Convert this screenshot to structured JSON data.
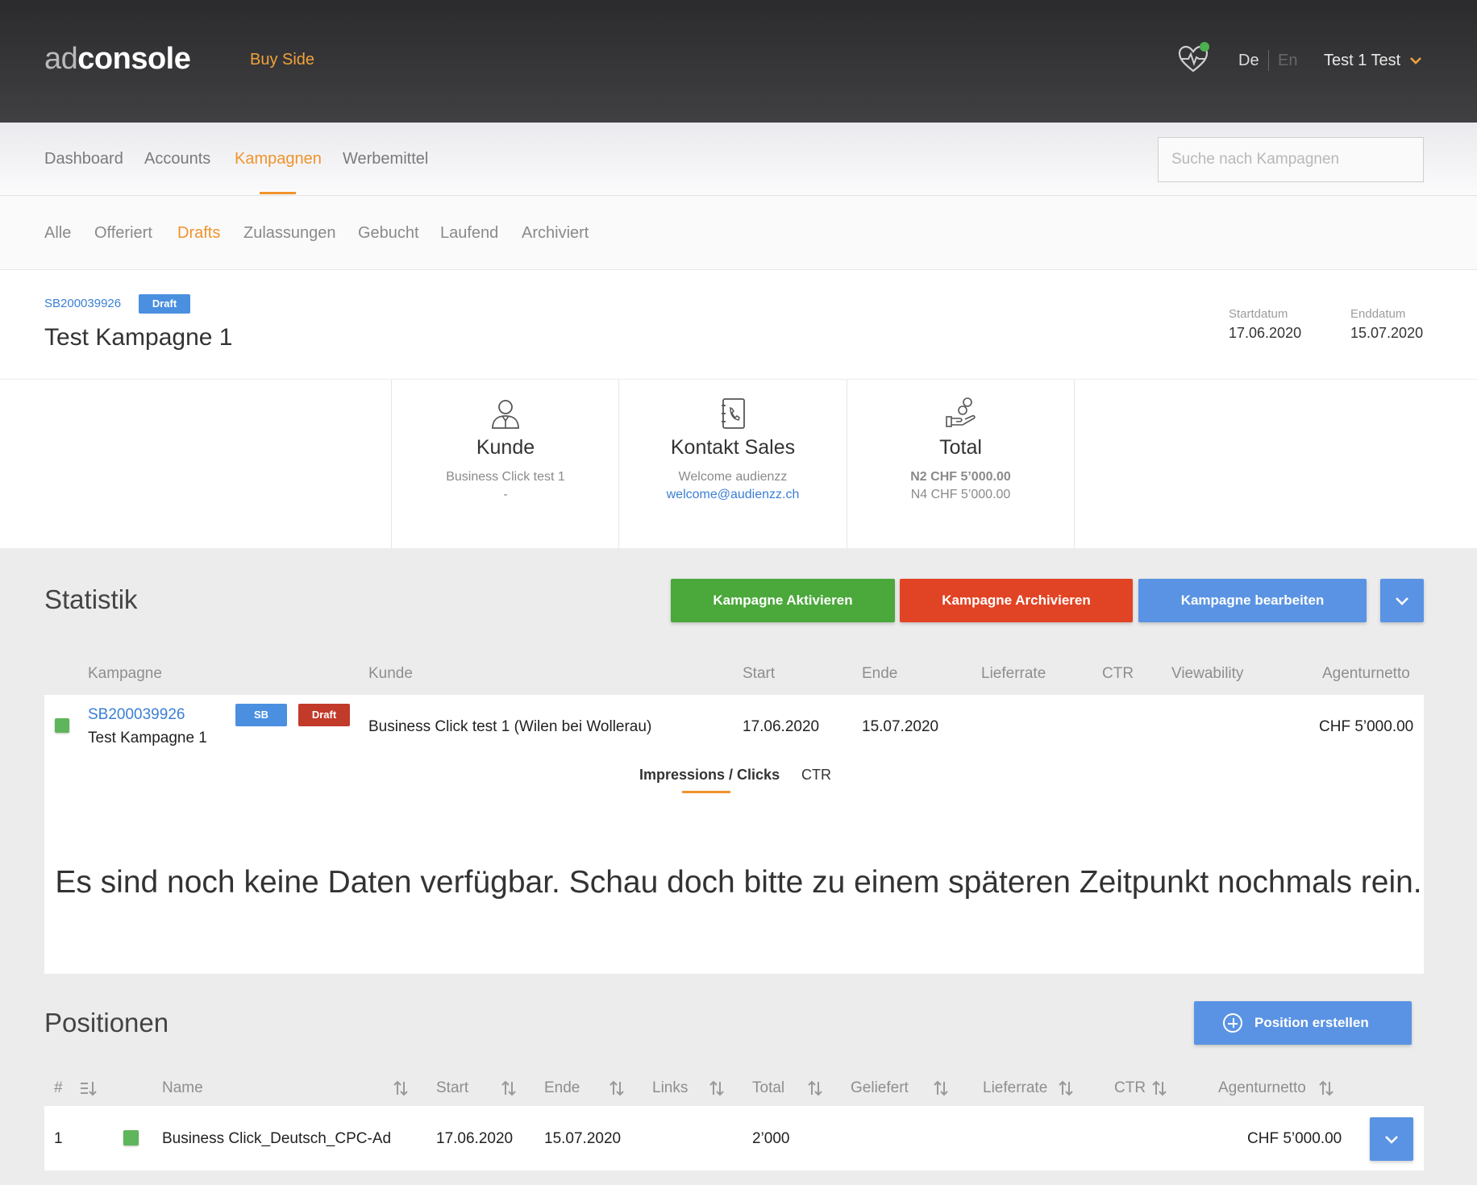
{
  "header": {
    "logo_part1": "ad",
    "logo_part2": "console",
    "section": "Buy Side",
    "lang_de": "De",
    "lang_en": "En",
    "user": "Test 1 Test"
  },
  "main_nav": {
    "items": [
      "Dashboard",
      "Accounts",
      "Kampagnen",
      "Werbemittel"
    ],
    "active": "Kampagnen",
    "search_placeholder": "Suche nach Kampagnen"
  },
  "sub_nav": {
    "items": [
      "Alle",
      "Offeriert",
      "Drafts",
      "Zulassungen",
      "Gebucht",
      "Laufend",
      "Archiviert"
    ],
    "active": "Drafts"
  },
  "campaign": {
    "id": "SB200039926",
    "status": "Draft",
    "title": "Test Kampagne 1",
    "start_label": "Startdatum",
    "start": "17.06.2020",
    "end_label": "Enddatum",
    "end": "15.07.2020"
  },
  "cards": {
    "kunde": {
      "title": "Kunde",
      "line1": "Business Click test 1",
      "line2": "-"
    },
    "kontakt": {
      "title": "Kontakt Sales",
      "line1": "Welcome audienzz",
      "line2": "welcome@audienzz.ch"
    },
    "total": {
      "title": "Total",
      "line1": "N2 CHF 5’000.00",
      "line2": "N4 CHF 5’000.00"
    }
  },
  "statistik": {
    "title": "Statistik",
    "buttons": {
      "activate": "Kampagne Aktivieren",
      "archive": "Kampagne Archivieren",
      "edit": "Kampagne bearbeiten"
    },
    "columns": [
      "Kampagne",
      "Kunde",
      "Start",
      "Ende",
      "Lieferrate",
      "CTR",
      "Viewability",
      "Agenturnetto"
    ],
    "row": {
      "id": "SB200039926",
      "name": "Test Kampagne 1",
      "tag1": "SB",
      "tag2": "Draft",
      "kunde": "Business Click test 1 (Wilen bei Wollerau)",
      "start": "17.06.2020",
      "ende": "15.07.2020",
      "agenturnetto": "CHF 5’000.00"
    },
    "tabs": [
      "Impressions / Clicks",
      "CTR"
    ],
    "active_tab": "Impressions / Clicks",
    "empty_message": "Es sind noch keine Daten verfügbar. Schau doch bitte zu einem späteren Zeitpunkt nochmals rein."
  },
  "positionen": {
    "title": "Positionen",
    "create_button": "Position erstellen",
    "columns": [
      "#",
      "Name",
      "Start",
      "Ende",
      "Links",
      "Total",
      "Geliefert",
      "Lieferrate",
      "CTR",
      "Agenturnetto"
    ],
    "rows": [
      {
        "num": "1",
        "name": "Business Click_Deutsch_CPC-Ad",
        "start": "17.06.2020",
        "ende": "15.07.2020",
        "total": "2’000",
        "agenturnetto": "CHF 5’000.00"
      }
    ]
  },
  "colors": {
    "accent": "#f0932b",
    "link": "#3b7fd4",
    "green": "#4ba83b",
    "red": "#e14424",
    "blue": "#5a93e3"
  },
  "icons": [
    "heartbeat-icon",
    "customer-icon",
    "phone-book-icon",
    "money-hand-icon",
    "chevron-down-icon",
    "sort-icon",
    "plus-circle-icon"
  ]
}
